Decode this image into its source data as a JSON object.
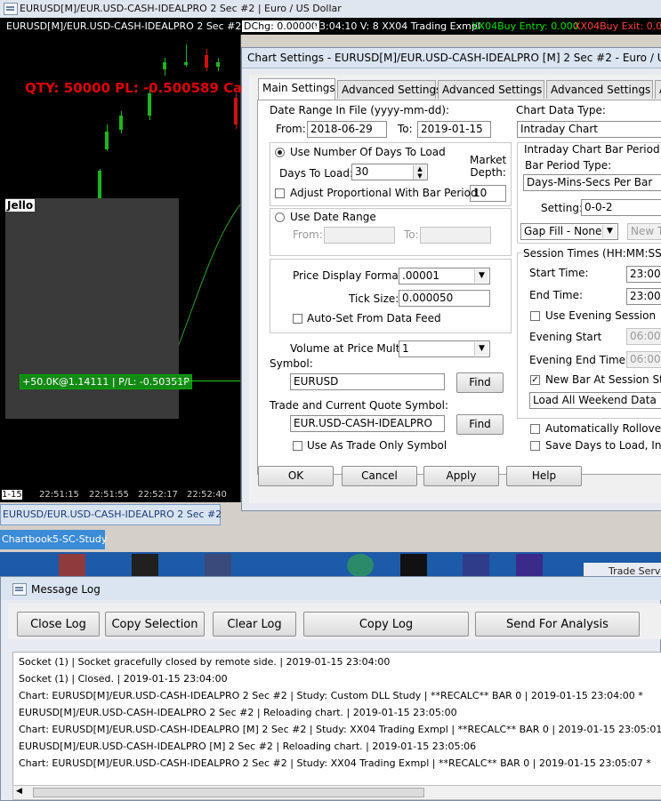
{
  "window": {
    "title": "EURUSD[M]/EUR.USD-CASH-IDEALPRO  2 Sec  #2 | Euro / US Dollar"
  },
  "chart": {
    "header": {
      "symbol": "EURUSD[M]/EUR.USD-CASH-IDEALPRO  2 Sec  #2",
      "dchg": "DChg: 0.00000",
      "time_vol": "23:04:10 V: 8 XX04 Trading Exmpl",
      "buy_entry": "XX04Buy Entry: 0.000",
      "buy_exit": "XX04Buy Exit: 0.000"
    },
    "qty_pl": "QTY: 50000  PL: -0.500589 Calc",
    "jello": "Jello",
    "position_label": "+50.0K@1.14111 | P/L: -0.50351P",
    "time_labels": [
      "1-15",
      "22:51:15",
      "22:51:55",
      "22:52:17",
      "22:52:40"
    ]
  },
  "chart_tab": "EURUSD/EUR.USD-CASH-IDEALPRO  2 Sec  #2",
  "chartbook_tab": "Chartbook5-SC-Study",
  "trade_service": "Trade Servi",
  "dialog": {
    "title": "Chart Settings - EURUSD[M]/EUR.USD-CASH-IDEALPRO [M]  2 Sec  #2 - Euro / US Dollar",
    "tabs": [
      "Main Settings",
      "Advanced Settings",
      "Advanced Settings 2",
      "Advanced Settings 3",
      "A"
    ],
    "date_range_label": "Date Range In File (yyyy-mm-dd):",
    "from_label": "From:",
    "from_value": "2018-06-29",
    "to_label": "To:",
    "to_value": "2019-01-15",
    "use_days_label": "Use Number Of Days To Load",
    "days_to_load_label": "Days To Load:",
    "days_to_load_value": "30",
    "market_depth_label": "Market\nDepth:",
    "market_depth_value": "10",
    "adjust_label": "Adjust Proportional With Bar Period",
    "use_date_range_label": "Use Date Range",
    "dr_from": "From:",
    "dr_to": "To:",
    "price_format_label": "Price Display Format:",
    "price_format_value": ".00001",
    "tick_size_label": "Tick Size:",
    "tick_size_value": "0.000050",
    "auto_set_label": "Auto-Set From Data Feed",
    "vol_mult_label": "Volume at Price Mult.:",
    "vol_mult_value": "1",
    "symbol_label": "Symbol:",
    "symbol_value": "EURUSD",
    "find_label": "Find",
    "trade_symbol_label": "Trade and Current Quote Symbol:",
    "trade_symbol_value": "EUR.USD-CASH-IDEALPRO",
    "trade_only_label": "Use As Trade Only Symbol",
    "chart_data_type_label": "Chart Data Type:",
    "chart_data_type_value": "Intraday Chart",
    "intraday_bar_label": "Intraday Chart Bar Period:",
    "bar_period_type_label": "Bar Period Type:",
    "bar_period_type_value": "Days-Mins-Secs Per Bar",
    "setting_label": "Setting:",
    "setting_value": "0-0-2",
    "gap_fill_value": "Gap Fill - None",
    "new_t": "New T",
    "session_label": "Session Times (HH:MM:SS)",
    "start_time_label": "Start Time:",
    "start_time_value": "23:00:0",
    "end_time_label": "End Time:",
    "end_time_value": "23:00:0",
    "use_evening_label": "Use Evening Session",
    "evening_start_label": "Evening Start",
    "evening_start_value": "06:00:0",
    "evening_end_label": "Evening End Time:",
    "evening_end_value": "06:00:0",
    "new_bar_label": "New Bar At Session Star",
    "weekend_value": "Load All Weekend Data",
    "auto_rollover_label": "Automatically Rollover F",
    "save_days_label": "Save Days to Load, Intra",
    "ok": "OK",
    "cancel": "Cancel",
    "apply": "Apply",
    "help": "Help"
  },
  "log": {
    "title": "Message Log",
    "buttons": [
      "Close Log",
      "Copy Selection",
      "Clear Log",
      "Copy Log",
      "Send For Analysis"
    ],
    "lines": [
      "Socket (1) | Socket gracefully closed by remote side. | 2019-01-15  23:04:00",
      "Socket (1) | Closed. | 2019-01-15  23:04:00",
      "Chart: EURUSD[M]/EUR.USD-CASH-IDEALPRO  2 Sec   #2 | Study: Custom DLL Study | **RECALC** BAR 0 | 2019-01-15  23:04:00 *",
      "EURUSD[M]/EUR.USD-CASH-IDEALPRO  2 Sec   #2 | Reloading chart. | 2019-01-15  23:05:00",
      "Chart: EURUSD[M]/EUR.USD-CASH-IDEALPRO [M]  2 Sec   #2 | Study: XX04 Trading Exmpl | **RECALC** BAR 0 | 2019-01-15  23:05:01 *",
      "EURUSD[M]/EUR.USD-CASH-IDEALPRO [M]  2 Sec   #2 | Reloading chart. | 2019-01-15  23:05:06",
      "Chart: EURUSD[M]/EUR.USD-CASH-IDEALPRO  2 Sec   #2 | Study: XX04 Trading Exmpl | **RECALC** BAR 0 | 2019-01-15  23:05:07 *"
    ]
  },
  "colors": {
    "chart_bg": "#000000",
    "candle_up": "#1db51d",
    "candle_down": "#d01010",
    "qty_text": "#e00000",
    "buy_entry": "#00e000",
    "buy_exit": "#ff4040"
  }
}
